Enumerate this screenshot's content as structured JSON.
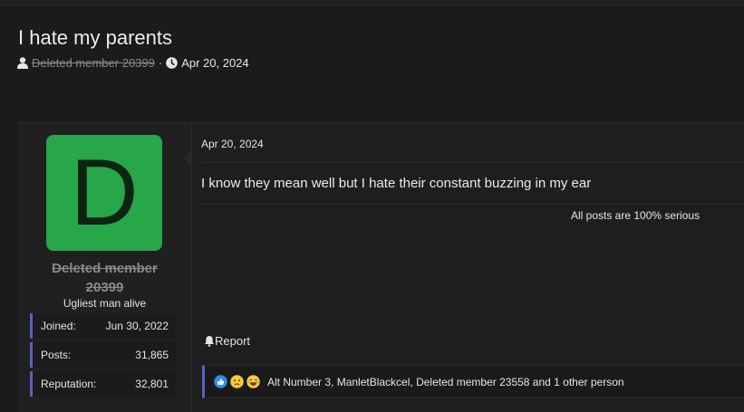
{
  "thread": {
    "title": "I hate my parents",
    "author": "Deleted member 20399",
    "date": "Apr 20, 2024"
  },
  "post": {
    "avatar_letter": "D",
    "avatar_color": "#27a64a",
    "username_line1": "Deleted member",
    "username_line2": "20399",
    "user_title": "Ugliest man alive",
    "stats": [
      {
        "label": "Joined:",
        "value": "Jun 30, 2022"
      },
      {
        "label": "Posts:",
        "value": "31,865"
      },
      {
        "label": "Reputation:",
        "value": "32,801"
      }
    ],
    "date": "Apr 20, 2024",
    "body": "I know they mean well but I hate their constant buzzing in my ear",
    "signature": "All posts are 100% serious",
    "report_label": "Report",
    "reactions": {
      "icons": [
        "like-icon",
        "sad-icon",
        "laugh-cry-icon"
      ],
      "text": "Alt Number 3, ManletBlackcel, Deleted member 23558 and 1 other person"
    }
  },
  "colors": {
    "accent": "#5b5fc2",
    "background": "#1b1b1b"
  }
}
